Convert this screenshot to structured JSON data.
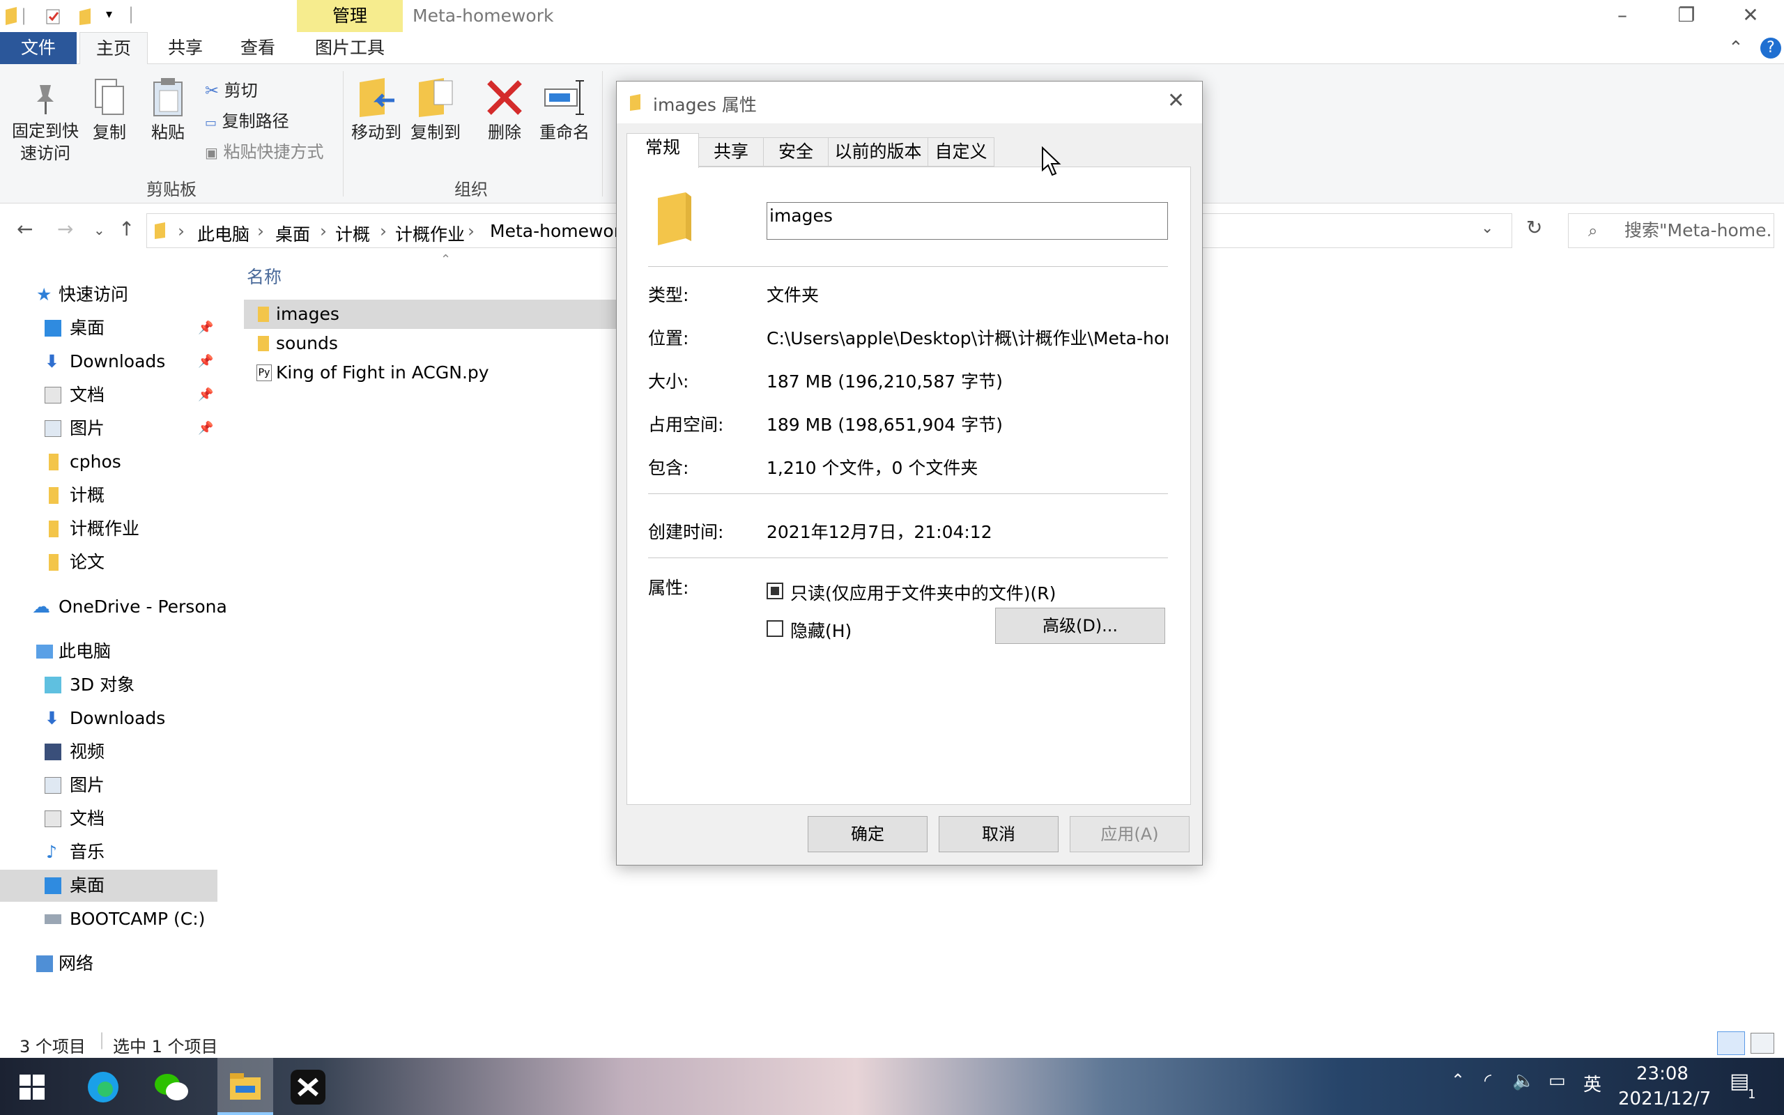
{
  "window": {
    "manage_tab": "管理",
    "title": "Meta-homework",
    "minimize_icon": "minimize-icon",
    "restore_icon": "restore-icon",
    "close_icon": "close-icon"
  },
  "ribbon": {
    "tabs": [
      "文件",
      "主页",
      "共享",
      "查看",
      "图片工具"
    ],
    "clipboard": {
      "pin_label_line1": "固定到快",
      "pin_label_line2": "速访问",
      "copy": "复制",
      "paste": "粘贴",
      "cut": "剪切",
      "copy_path": "复制路径",
      "paste_shortcut": "粘贴快捷方式",
      "group": "剪贴板"
    },
    "organize": {
      "move_to": "移动到",
      "copy_to": "复制到",
      "delete": "删除",
      "rename": "重命名",
      "group": "组织"
    }
  },
  "address": {
    "crumbs": [
      "此电脑",
      "桌面",
      "计概",
      "计概作业",
      "Meta-homework"
    ],
    "search_placeholder": "搜索\"Meta-home..."
  },
  "sidebar": {
    "items": [
      {
        "label": "快速访问",
        "icon": "star-icon"
      },
      {
        "label": "桌面",
        "icon": "desktop-icon",
        "pinned": true
      },
      {
        "label": "Downloads",
        "icon": "download-icon",
        "pinned": true
      },
      {
        "label": "文档",
        "icon": "document-icon",
        "pinned": true
      },
      {
        "label": "图片",
        "icon": "picture-icon",
        "pinned": true
      },
      {
        "label": "cphos",
        "icon": "folder-icon"
      },
      {
        "label": "计概",
        "icon": "folder-icon"
      },
      {
        "label": "计概作业",
        "icon": "folder-icon"
      },
      {
        "label": "论文",
        "icon": "folder-icon"
      },
      {
        "label": "OneDrive - Persona",
        "icon": "onedrive-icon"
      },
      {
        "label": "此电脑",
        "icon": "pc-icon"
      },
      {
        "label": "3D 对象",
        "icon": "cube-icon"
      },
      {
        "label": "Downloads",
        "icon": "download-icon"
      },
      {
        "label": "视频",
        "icon": "video-icon"
      },
      {
        "label": "图片",
        "icon": "picture-icon"
      },
      {
        "label": "文档",
        "icon": "document-icon"
      },
      {
        "label": "音乐",
        "icon": "music-icon"
      },
      {
        "label": "桌面",
        "icon": "desktop-icon"
      },
      {
        "label": "BOOTCAMP (C:)",
        "icon": "drive-icon"
      },
      {
        "label": "网络",
        "icon": "network-icon"
      }
    ]
  },
  "filelist": {
    "column_name": "名称",
    "files": [
      {
        "name": "images",
        "icon": "folder-icon"
      },
      {
        "name": "sounds",
        "icon": "folder-icon"
      },
      {
        "name": "King of Fight in ACGN.py",
        "icon": "python-file-icon"
      }
    ]
  },
  "status": {
    "count": "3 个项目",
    "selected": "选中 1 个项目"
  },
  "dialog": {
    "title": "images 属性",
    "tabs": [
      "常规",
      "共享",
      "安全",
      "以前的版本",
      "自定义"
    ],
    "name": "images",
    "type_label": "类型:",
    "type_value": "文件夹",
    "location_label": "位置:",
    "location_value": "C:\\Users\\apple\\Desktop\\计概\\计概作业\\Meta-homework",
    "size_label": "大小:",
    "size_value": "187 MB (196,210,587 字节)",
    "disk_label": "占用空间:",
    "disk_value": "189 MB (198,651,904 字节)",
    "contains_label": "包含:",
    "contains_value": "1,210 个文件，0 个文件夹",
    "created_label": "创建时间:",
    "created_value": "2021年12月7日，21:04:12",
    "attr_label": "属性:",
    "readonly_label": "只读(仅应用于文件夹中的文件)(R)",
    "hidden_label": "隐藏(H)",
    "advanced_button": "高级(D)...",
    "ok_button": "确定",
    "cancel_button": "取消",
    "apply_button": "应用(A)"
  },
  "taskbar": {
    "time": "23:08",
    "date": "2021/12/7",
    "ime": "英",
    "notification_count": "1"
  }
}
